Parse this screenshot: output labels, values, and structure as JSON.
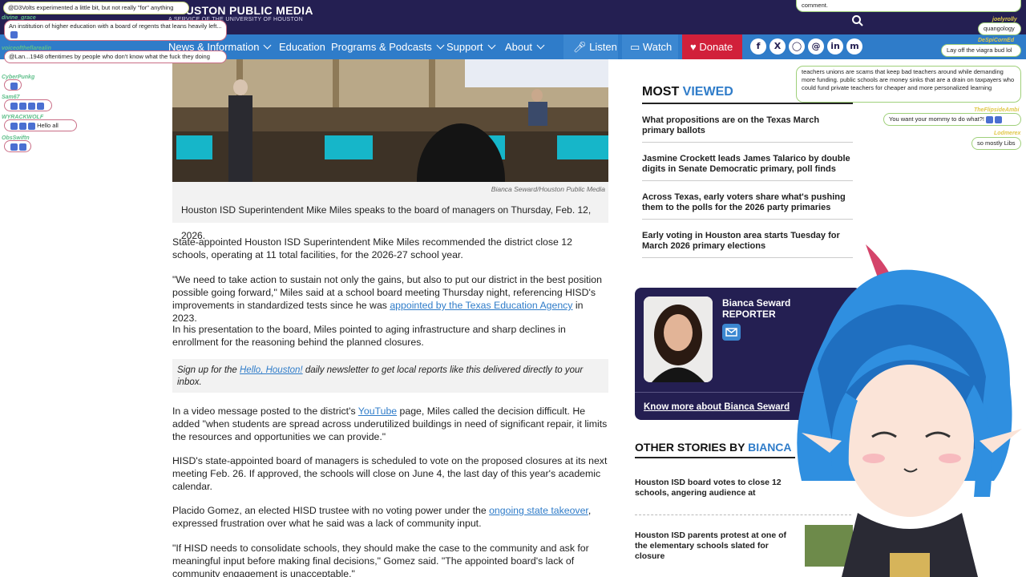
{
  "header": {
    "logo_title": "HOUSTON PUBLIC MEDIA",
    "logo_sub": "A SERVICE OF THE UNIVERSITY OF HOUSTON",
    "nav": [
      "News & Information",
      "Education",
      "Programs & Podcasts",
      "Support",
      "About"
    ],
    "listen": "Listen",
    "watch": "Watch",
    "donate": "Donate",
    "social_icons": [
      "facebook-icon",
      "x-icon",
      "instagram-icon",
      "threads-icon",
      "linkedin-icon",
      "mastodon-icon"
    ]
  },
  "article": {
    "photo_credit": "Bianca Seward/Houston Public Media",
    "caption": "Houston ISD Superintendent Mike Miles speaks to the board of managers on Thursday, Feb. 12, 2026.",
    "p1": "State-appointed Houston ISD Superintendent Mike Miles recommended the district close 12 schools, operating at 11 total facilities, for the 2026-27 school year.",
    "p2_a": "\"We need to take action to sustain not only the gains, but also to put our district in the best position possible going forward,\" Miles said at a school board meeting Thursday night, referencing HISD's improvements in standardized tests since he was ",
    "p2_link": "appointed by the Texas Education Agency",
    "p2_b": " in 2023.",
    "p3": "In his presentation to the board, Miles pointed to aging infrastructure and sharp declines in enrollment for the reasoning behind the planned closures.",
    "signup_a": "Sign up for the ",
    "signup_link": "Hello, Houston!",
    "signup_b": " daily newsletter to get local reports like this delivered directly to your inbox.",
    "p4_a": "In a video message posted to the district's ",
    "p4_link": "YouTube",
    "p4_b": " page, Miles called the decision difficult. He added \"when students are spread across underutilized buildings in need of significant repair, it limits the resources and opportunities we can provide.\"",
    "p5": "HISD's state-appointed board of managers is scheduled to vote on the proposed closures at its next meeting Feb. 26. If approved, the schools will close on June 4, the last day of this year's academic calendar.",
    "p6_a": "Placido Gomez, an elected HISD trustee with no voting power under the ",
    "p6_link": "ongoing state takeover",
    "p6_b": ", expressed frustration over what he said was a lack of community input.",
    "p7": "\"If HISD needs to consolidate schools, they should make the case to the community and ask for meaningful input before making final decisions,\" Gomez said. \"The appointed board's lack of community engagement is unacceptable.\""
  },
  "sidebar": {
    "most_viewed_a": "MOST ",
    "most_viewed_b": "VIEWED",
    "most_viewed": [
      "What propositions are on the Texas March primary ballots",
      "Jasmine Crockett leads James Talarico by double digits in Senate Democratic primary, poll finds",
      "Across Texas, early voters share what's pushing them to the polls for the 2026 party primaries",
      "Early voting in Houston area starts Tuesday for March 2026 primary elections"
    ],
    "author_name": "Bianca Seward",
    "author_role": "REPORTER",
    "author_more": "Know more about Bianca Seward",
    "other_a": "OTHER STORIES BY ",
    "other_b": "BIANCA",
    "other_stories": [
      "Houston ISD board votes to close 12 schools, angering audience at",
      "Houston ISD parents protest at one of the elementary schools slated for closure"
    ]
  },
  "chat_left": [
    {
      "name": "",
      "text": "@D3Volts experimented a little bit, but not really \"for\" anything"
    },
    {
      "name": "divine_grace",
      "text": "An institution of higher education with a board of regents that leans heavily left..."
    },
    {
      "name": "voiceoftheflarealin",
      "text": "@Lan...1948 oftentimes by people who don't know what the fuck they doing"
    },
    {
      "name": "CyberPunkg",
      "text": ""
    },
    {
      "name": "Sam67",
      "text": ""
    },
    {
      "name": "WYRACKWOLF",
      "text": "Hello all"
    },
    {
      "name": "ObsSwiftn",
      "text": ""
    }
  ],
  "chat_right": [
    {
      "name": "",
      "text": "comment."
    },
    {
      "name": "joelyrolly",
      "text": "quangology"
    },
    {
      "name": "DeSpiCornEd",
      "text": "Lay off the viagra bud lol"
    },
    {
      "name": "",
      "text": "teachers unions are scams that keep bad teachers around while demanding more funding. public schools are money sinks that are a drain on taxpayers who could fund private teachers for cheaper and more personalized learning"
    },
    {
      "name": "TheFlipsideAmbi",
      "text": "You want your mommy to do what?!"
    },
    {
      "name": "Lodmerex",
      "text": "so mostly Libs"
    }
  ]
}
